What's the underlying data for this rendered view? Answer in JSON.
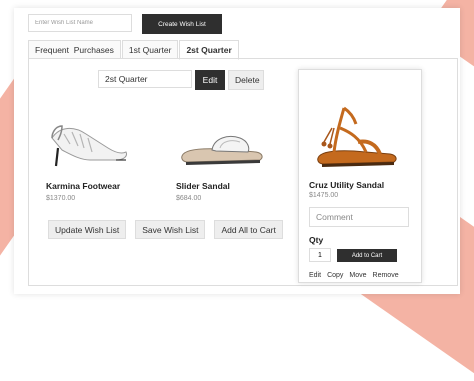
{
  "header": {
    "wishlist_placeholder": "Enter Wish List Name",
    "create_label": "Create Wish List"
  },
  "tabs": [
    {
      "label": "Frequent  Purchases"
    },
    {
      "label": "1st Quarter"
    },
    {
      "label": "2st Quarter",
      "active": true
    }
  ],
  "rename": {
    "value": "2st Quarter",
    "edit_label": "Edit",
    "delete_label": "Delete"
  },
  "products": [
    {
      "name": "Karmina Footwear",
      "price": "$1370.00",
      "icon": "slingback-heel-shoe"
    },
    {
      "name": "Slider Sandal",
      "price": "$684.00",
      "icon": "slide-sandal"
    }
  ],
  "actions": {
    "update_label": "Update Wish List",
    "save_label": "Save Wish List",
    "add_all_label": "Add All to Cart"
  },
  "side": {
    "name": "Cruz Utility Sandal",
    "price": "$1475.00",
    "icon": "tassel-sandal",
    "comment_placeholder": "Comment",
    "qty_label": "Qty",
    "qty_value": "1",
    "add_to_cart_label": "Add to Cart",
    "links": [
      "Edit",
      "Copy",
      "Move",
      "Remove"
    ]
  },
  "colors": {
    "accent_dark": "#2f2f2f",
    "decor": "#f4b3a4",
    "border": "#dddddd"
  }
}
